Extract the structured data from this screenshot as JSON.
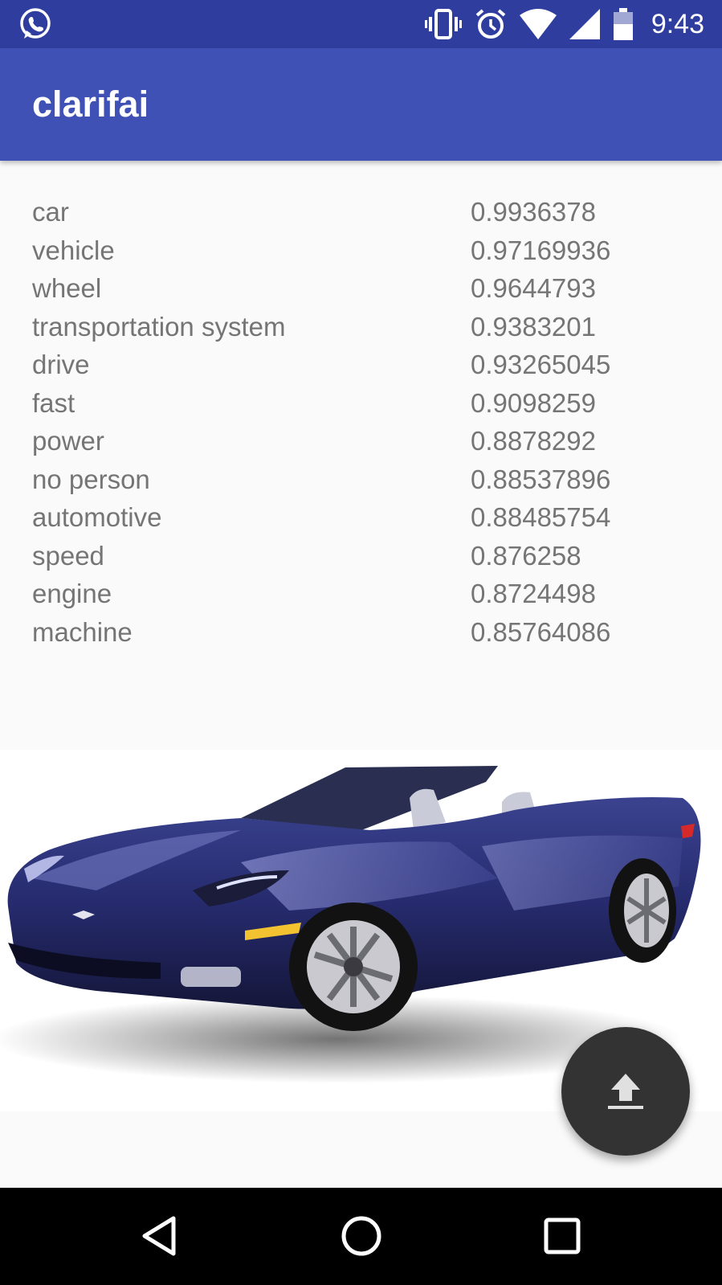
{
  "status_bar": {
    "time": "9:43",
    "icons": [
      "whatsapp-icon",
      "vibrate-icon",
      "alarm-icon",
      "wifi-icon",
      "signal-icon",
      "battery-icon"
    ]
  },
  "app_bar": {
    "title": "clarifai"
  },
  "results": [
    {
      "label": "car",
      "score": "0.9936378"
    },
    {
      "label": "vehicle",
      "score": "0.97169936"
    },
    {
      "label": "wheel",
      "score": "0.9644793"
    },
    {
      "label": "transportation system",
      "score": "0.9383201"
    },
    {
      "label": "drive",
      "score": "0.93265045"
    },
    {
      "label": "fast",
      "score": "0.9098259"
    },
    {
      "label": "power",
      "score": "0.8878292"
    },
    {
      "label": "no person",
      "score": "0.88537896"
    },
    {
      "label": "automotive",
      "score": "0.88485754"
    },
    {
      "label": "speed",
      "score": "0.876258"
    },
    {
      "label": "engine",
      "score": "0.8724498"
    },
    {
      "label": "machine",
      "score": "0.85764086"
    }
  ],
  "fab": {
    "icon": "upload-icon"
  },
  "nav_bar": {
    "icons": [
      "back-icon",
      "home-icon",
      "recents-icon"
    ]
  },
  "colors": {
    "status_bar": "#2f3e9e",
    "app_bar": "#3f51b5",
    "fab": "#333333",
    "text": "#757575"
  }
}
